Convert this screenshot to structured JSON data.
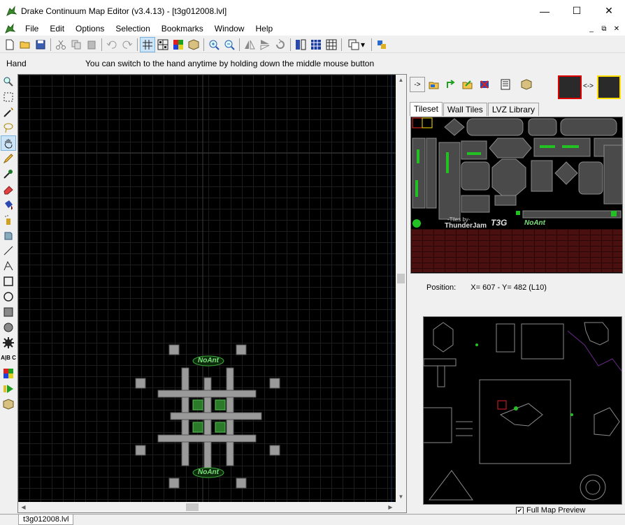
{
  "window": {
    "title": "Drake Continuum Map Editor (v3.4.13) - [t3g012008.lvl]",
    "minimize": "—",
    "maximize": "☐",
    "close": "✕"
  },
  "menu": {
    "items": [
      "File",
      "Edit",
      "Options",
      "Selection",
      "Bookmarks",
      "Window",
      "Help"
    ],
    "mdi": [
      "_",
      "⧉",
      "✕"
    ]
  },
  "toolbar": {
    "icons": [
      "new-icon",
      "open-icon",
      "save-icon",
      "cut-icon",
      "copy-icon",
      "paste-icon",
      "undo-icon",
      "redo-icon",
      "grid-icon",
      "screen-grid-icon",
      "color-icon",
      "lvz-icon",
      "zoom-in-icon",
      "zoom-out-icon",
      "mirror-h-icon",
      "mirror-v-icon",
      "rotate-icon",
      "region-icon",
      "tile-grid-icon",
      "fill-icon",
      "layers-icon",
      "settings-icon"
    ],
    "dropdown_arrow": "▾"
  },
  "info": {
    "mode": "Hand",
    "hint": "You can switch to the hand anytime by holding down the middle mouse button"
  },
  "tools": [
    "magnifier-icon",
    "select-rect-icon",
    "magic-wand-icon",
    "lasso-icon",
    "hand-icon",
    "pencil-icon",
    "dropper-icon",
    "eraser-icon",
    "bucket-icon",
    "spray-icon",
    "replace-icon",
    "line-icon",
    "spline-icon",
    "rectangle-icon",
    "ellipse-icon",
    "filled-rect-icon",
    "filled-ellipse-icon",
    "gear-icon",
    "text-icon",
    "color-swatch-icon",
    "play-icon",
    "cube-icon"
  ],
  "tools_text": "A|B C",
  "scroll": {
    "up": "▲",
    "down": "▼",
    "left": "◀",
    "right": "▶"
  },
  "map": {
    "logo_top": "NoAnt",
    "logo_bottom": "NoAnt"
  },
  "right_panel": {
    "swap": "<->",
    "tabs": [
      "Tileset",
      "Wall Tiles",
      "LVZ Library"
    ],
    "active_tab": "Tileset",
    "tileset_credit_1": "-Tiles by-",
    "tileset_credit_2": "ThunderJam",
    "tileset_logo": "T3G",
    "tileset_logo_2": "NoAnt",
    "position_label": "Position:",
    "position_value": "X= 607 - Y= 482 (L10)",
    "full_map_label": "Full Map Preview",
    "full_map_checked": "✔"
  },
  "doc_tab": "t3g012008.lvl",
  "colors": {
    "map_bg": "#000000",
    "grid": "#1d1d1d",
    "accent_green": "#22c022",
    "selection_red": "#e00000",
    "selection_yellow": "#ffe000"
  }
}
